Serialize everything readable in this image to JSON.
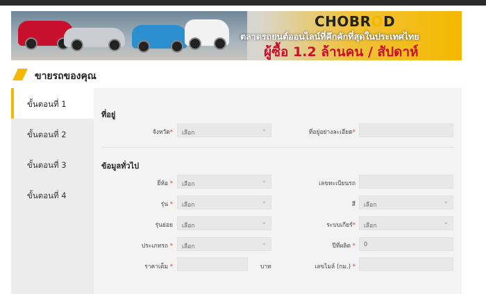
{
  "banner": {
    "logo_prefix": "CHOBR",
    "logo_o": "O",
    "logo_suffix": "D",
    "tagline": "ตลาดรถยนต์ออนไลน์ที่คึกคักที่สุดในประเทศไทย",
    "headline": "ผู้ซื้อ 1.2 ล้านคน / สัปดาห์",
    "colors": {
      "accent": "#f5b800",
      "headline": "#c8102e"
    }
  },
  "page": {
    "title": "ขายรถของคุณ"
  },
  "steps": [
    {
      "label": "ขั้นตอนที่ 1",
      "active": true
    },
    {
      "label": "ขั้นตอนที่ 2",
      "active": false
    },
    {
      "label": "ขั้นตอนที่ 3",
      "active": false
    },
    {
      "label": "ขั้นตอนที่ 4",
      "active": false
    }
  ],
  "address": {
    "title": "ที่อยู่",
    "province_label": "จังหวัด",
    "province_value": "เลือก",
    "detail_label": "ที่อยู่อย่างละเอียด",
    "detail_value": ""
  },
  "general": {
    "title": "ข้อมูลทั่วไป",
    "brand_label": "ยี่ห้อ",
    "brand_value": "เลือก",
    "plate_label": "เลขทะเบียนรถ",
    "plate_value": "",
    "model_label": "รุ่น",
    "model_value": "เลือก",
    "color_label": "สี",
    "color_value": "เลือก",
    "submodel_label": "รุ่นย่อย",
    "submodel_value": "เลือก",
    "gear_label": "ระบบเกียร์",
    "gear_value": "เลือก",
    "type_label": "ประเภทรถ",
    "type_value": "เลือก",
    "year_label": "ปีที่ผลิต",
    "year_value": "0",
    "price_label": "ราคาเต็ม",
    "price_value": "",
    "price_unit": "บาท",
    "mileage_label": "เลขไมล์ (กม.)",
    "mileage_value": ""
  },
  "required_mark": "*",
  "icons": {
    "dropdown": "chevron-down-icon"
  }
}
